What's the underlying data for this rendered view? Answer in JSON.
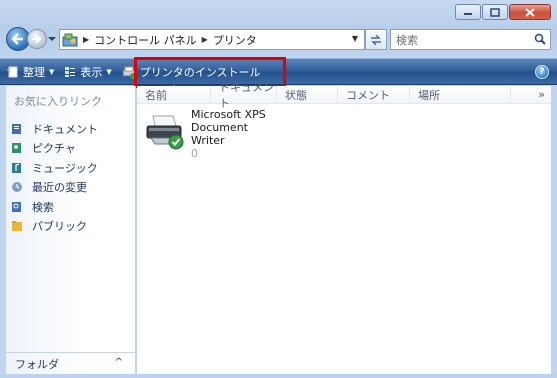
{
  "window": {
    "title": "",
    "controls": {
      "minimize": "minimize",
      "maximize": "maximize",
      "close": "close"
    }
  },
  "address": {
    "breadcrumbs": [
      "コントロール パネル",
      "プリンタ"
    ],
    "search_placeholder": "検索"
  },
  "toolbar": {
    "organize": "整理",
    "views": "表示",
    "add_printer": "プリンタのインストール"
  },
  "navpane": {
    "header": "お気に入りリンク",
    "items": [
      {
        "label": "ドキュメント",
        "icon": "documents-icon"
      },
      {
        "label": "ピクチャ",
        "icon": "pictures-icon"
      },
      {
        "label": "ミュージック",
        "icon": "music-icon"
      },
      {
        "label": "最近の変更",
        "icon": "recent-changes-icon"
      },
      {
        "label": "検索",
        "icon": "searches-icon"
      },
      {
        "label": "パブリック",
        "icon": "public-folder-icon"
      }
    ],
    "folders_label": "フォルダ"
  },
  "content": {
    "columns": [
      "名前",
      "ドキュメント",
      "状態",
      "コメント",
      "場所"
    ],
    "more": "»",
    "printers": [
      {
        "name_line1": "Microsoft XPS Document",
        "name_line2": "Writer",
        "jobs": "0"
      }
    ]
  },
  "colors": {
    "toolbar": "#2d5c98",
    "highlight": "#e00000",
    "frame": "#bfd4ee"
  }
}
